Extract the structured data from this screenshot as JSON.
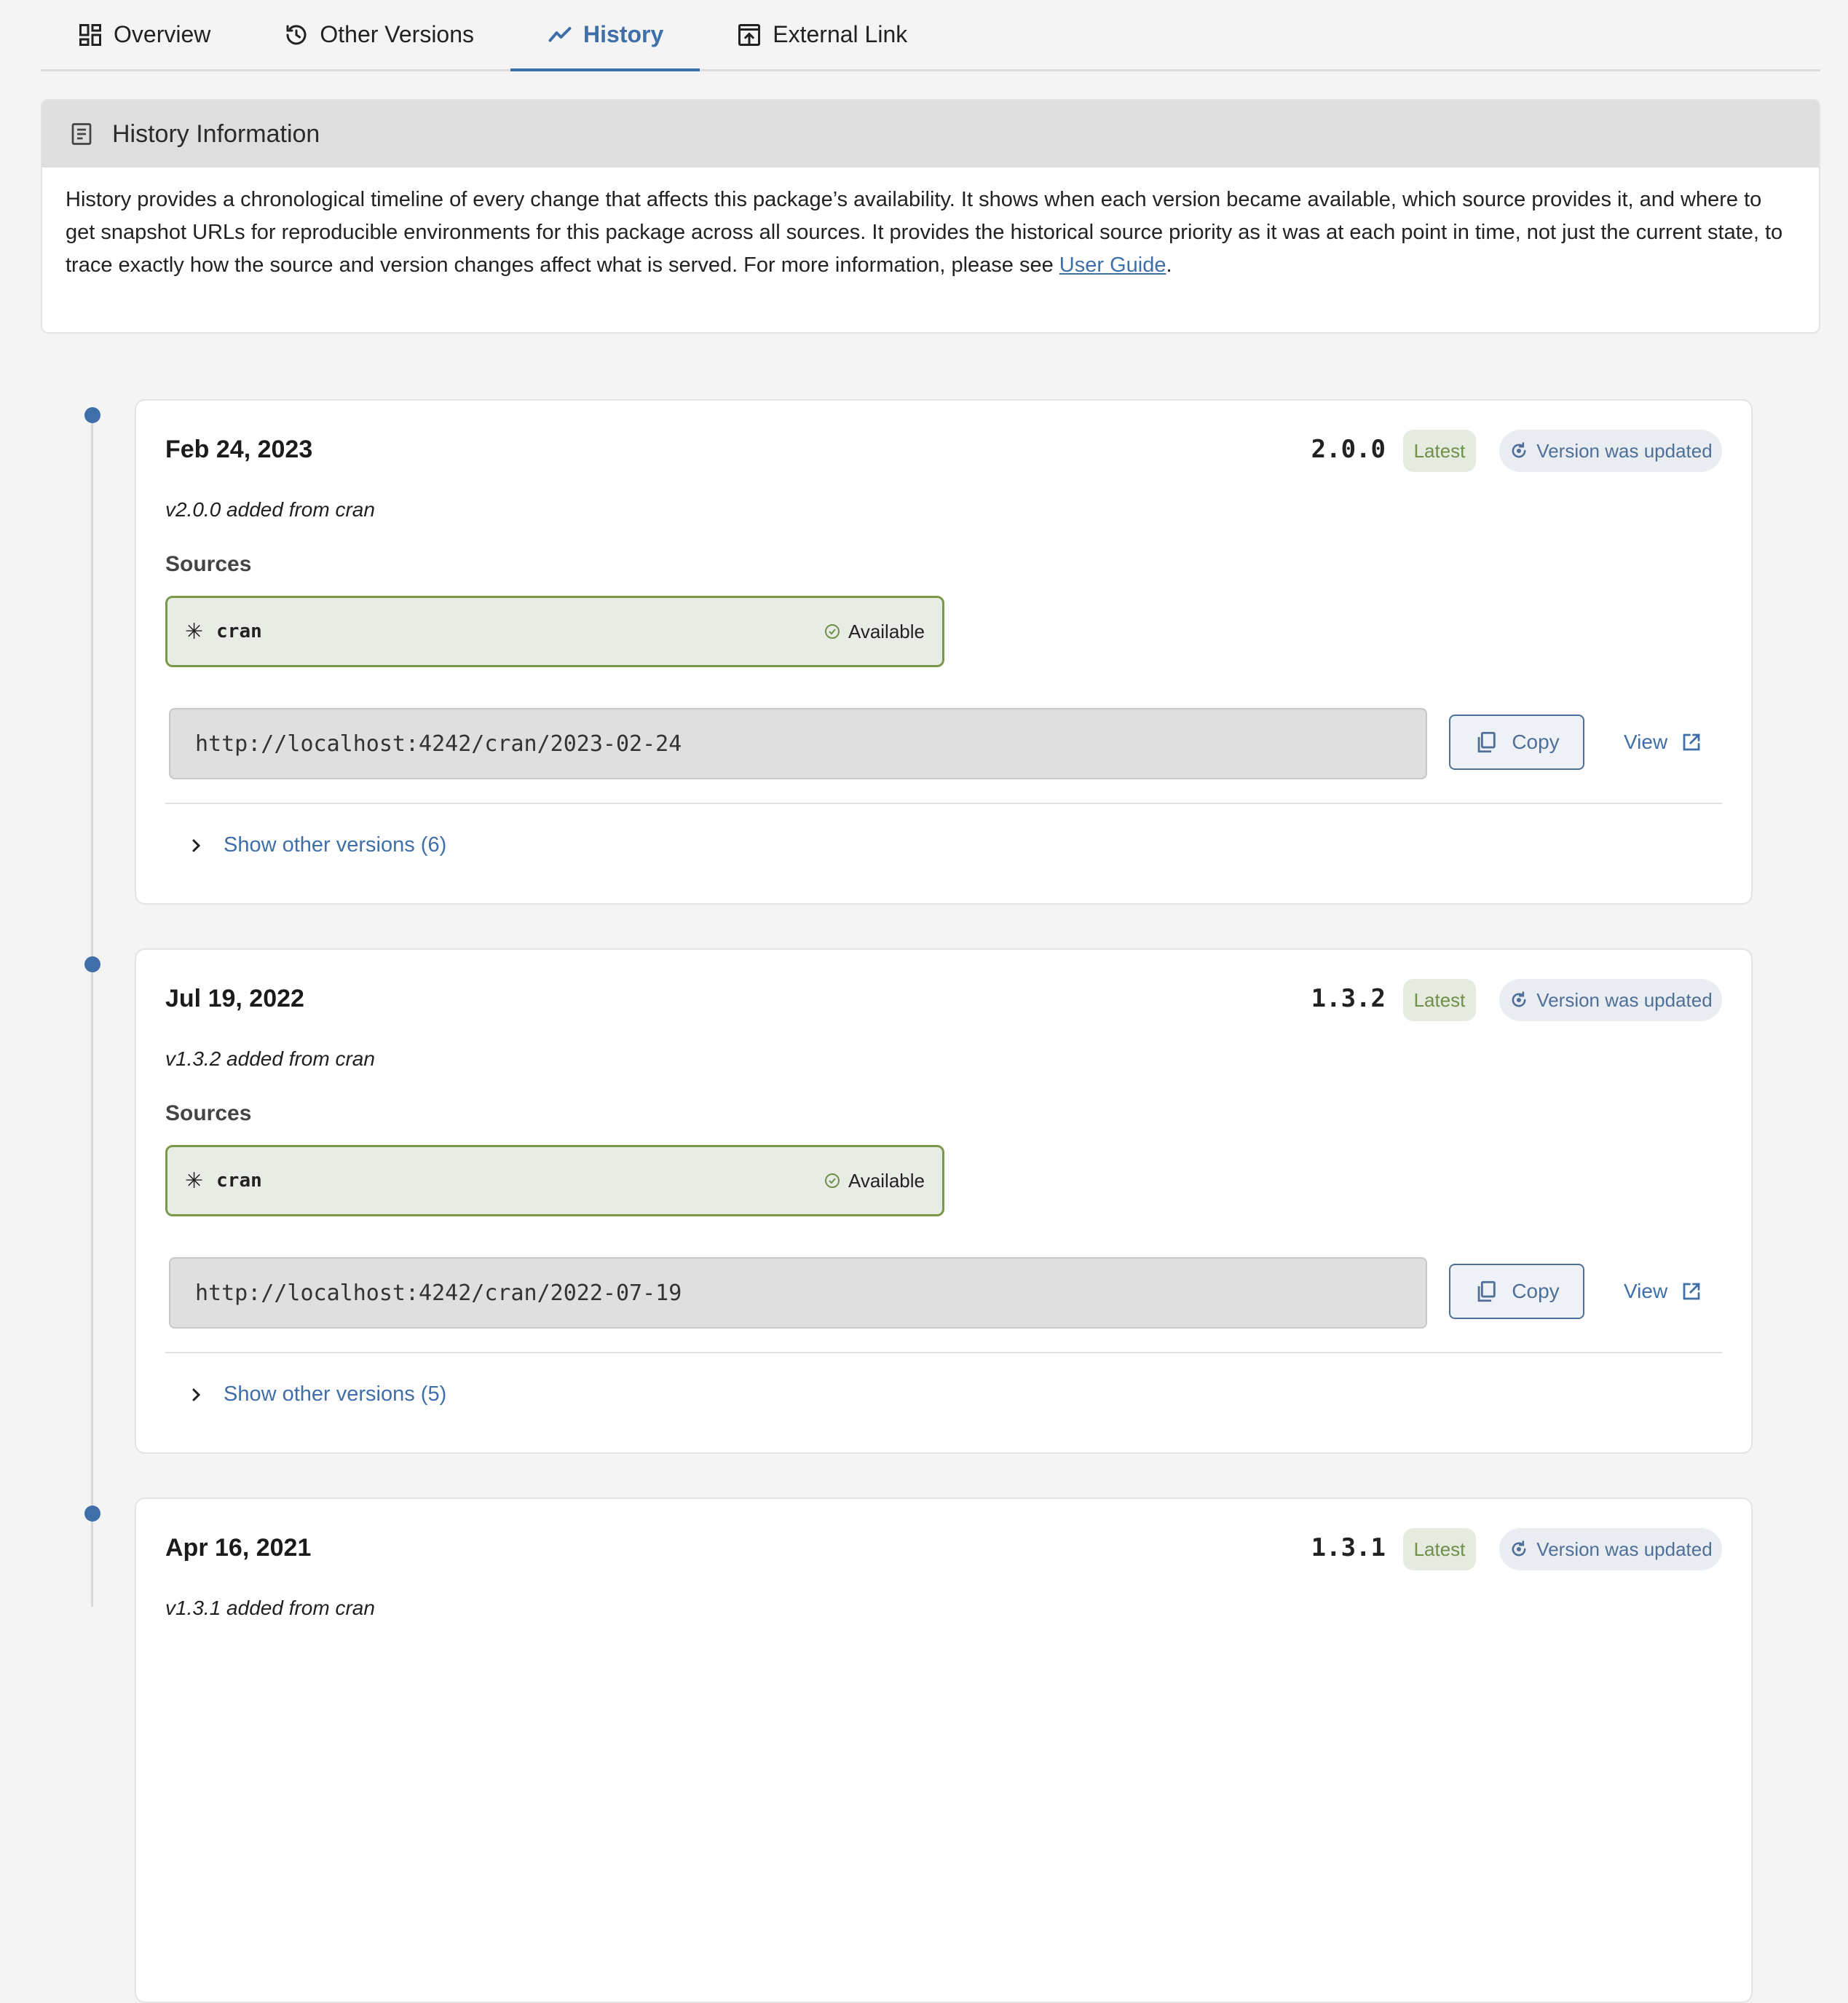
{
  "tabs": [
    {
      "label": "Overview",
      "icon": "dashboard-icon",
      "active": false
    },
    {
      "label": "Other Versions",
      "icon": "history-icon",
      "active": false
    },
    {
      "label": "History",
      "icon": "trend-line-icon",
      "active": true
    },
    {
      "label": "External Link",
      "icon": "external-link-box-icon",
      "active": false
    }
  ],
  "info": {
    "title": "History Information",
    "body_text": "History provides a chronological timeline of every change that affects this package’s availability. It shows when each version became available, which source provides it, and where to get snapshot URLs for reproducible environments for this package across all sources. It provides the historical source priority as it was at each point in time, not just the current state, to trace exactly how the source and version changes affect what is served. For more information, please see ",
    "link_text": "User Guide",
    "body_end": "."
  },
  "entries": [
    {
      "date": "Feb 24, 2023",
      "version": "2.0.0",
      "latest_label": "Latest",
      "updated_label": "Version was updated",
      "description": "v2.0.0 added from cran",
      "sources_label": "Sources",
      "source_name": "cran",
      "source_status": "Available",
      "url": "http://localhost:4242/cran/2023-02-24",
      "copy_label": "Copy",
      "view_label": "View",
      "show_other": "Show other versions (6)"
    },
    {
      "date": "Jul 19, 2022",
      "version": "1.3.2",
      "latest_label": "Latest",
      "updated_label": "Version was updated",
      "description": "v1.3.2 added from cran",
      "sources_label": "Sources",
      "source_name": "cran",
      "source_status": "Available",
      "url": "http://localhost:4242/cran/2022-07-19",
      "copy_label": "Copy",
      "view_label": "View",
      "show_other": "Show other versions (5)"
    },
    {
      "date": "Apr 16, 2021",
      "version": "1.3.1",
      "latest_label": "Latest",
      "updated_label": "Version was updated",
      "description": "v1.3.1 added from cran"
    }
  ],
  "colors": {
    "accent": "#3f6fa8",
    "available_border": "#7a9a4a",
    "latest_badge_bg": "#e6ebdf",
    "updated_badge_bg": "#e9edf2"
  }
}
